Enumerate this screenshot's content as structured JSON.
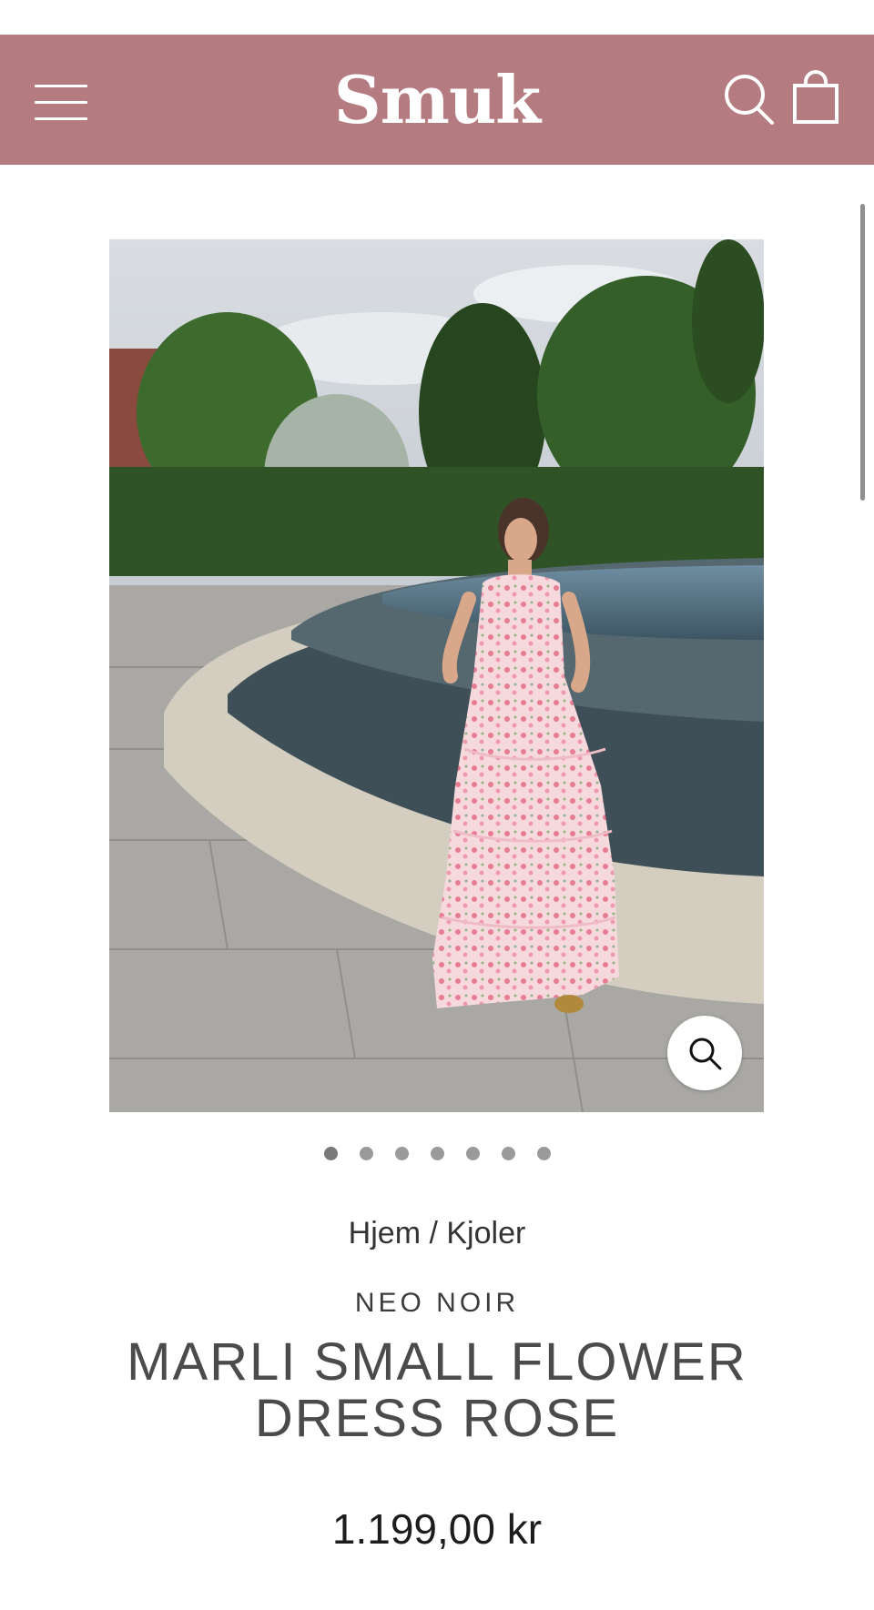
{
  "header": {
    "logo": "Smuk",
    "background_color": "#b47b80",
    "menu_icon": "hamburger-menu-icon",
    "search_icon": "search-icon",
    "cart_icon": "shopping-bag-icon"
  },
  "gallery": {
    "image_alt": "Kvinde i lyserød blomstret kjole ved springvand",
    "zoom_icon": "zoom-icon",
    "dot_count": 7,
    "active_dot": 1
  },
  "breadcrumb": {
    "home": "Hjem",
    "separator": "/",
    "category": "Kjoler"
  },
  "product": {
    "brand": "NEO NOIR",
    "title": "MARLI SMALL FLOWER DRESS ROSE",
    "price": "1.199,00 kr"
  }
}
